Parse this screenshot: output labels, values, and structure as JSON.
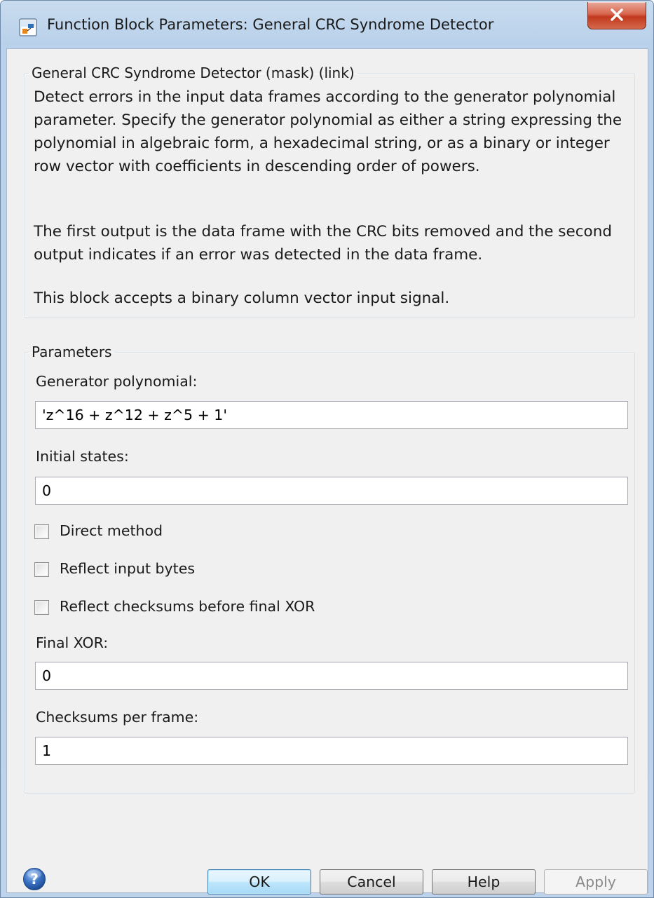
{
  "window": {
    "title": "Function Block Parameters: General CRC Syndrome Detector"
  },
  "description_group": {
    "legend": "General CRC Syndrome Detector (mask) (link)",
    "paragraphs": [
      "Detect errors in the input data frames according to the generator polynomial parameter. Specify the generator polynomial as either a string expressing the polynomial in algebraic form, a hexadecimal string, or as a binary or integer row vector with coefficients in descending order of powers.",
      "The first output is the data frame with the CRC bits removed and the second output indicates if an error was detected in the data frame.",
      "This block accepts a binary column vector input signal."
    ]
  },
  "parameters_group": {
    "legend": "Parameters",
    "generator_polynomial": {
      "label": "Generator polynomial:",
      "value": "'z^16 + z^12 + z^5 + 1'"
    },
    "initial_states": {
      "label": "Initial states:",
      "value": "0"
    },
    "direct_method": {
      "label": "Direct method",
      "checked": false
    },
    "reflect_input_bytes": {
      "label": "Reflect input bytes",
      "checked": false
    },
    "reflect_checksums": {
      "label": "Reflect checksums before final XOR",
      "checked": false
    },
    "final_xor": {
      "label": "Final XOR:",
      "value": "0"
    },
    "checksums_per_frame": {
      "label": "Checksums per frame:",
      "value": "1"
    }
  },
  "buttons": {
    "ok": "OK",
    "cancel": "Cancel",
    "help": "Help",
    "apply": "Apply"
  },
  "icons": {
    "app": "simulink-block-icon",
    "close": "close-icon",
    "help": "help-question-icon"
  },
  "colors": {
    "title_bar": "#bcd3eb",
    "client_bg": "#f0f0f0",
    "close_button": "#c2371d",
    "default_button": "#3c7fb1",
    "help_icon": "#3b72c4"
  }
}
